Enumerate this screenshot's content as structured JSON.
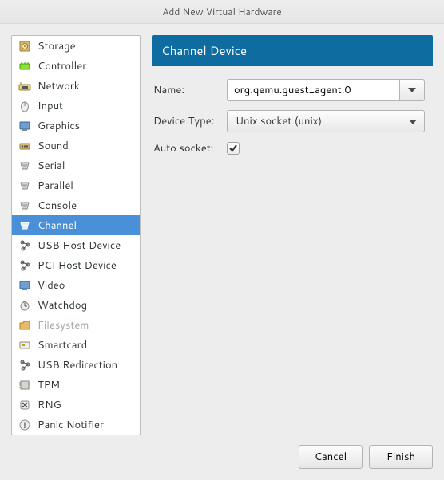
{
  "window": {
    "title": "Add New Virtual Hardware"
  },
  "sidebar": {
    "items": [
      {
        "label": "Storage",
        "icon": "storage",
        "selected": false,
        "disabled": false
      },
      {
        "label": "Controller",
        "icon": "controller",
        "selected": false,
        "disabled": false
      },
      {
        "label": "Network",
        "icon": "network",
        "selected": false,
        "disabled": false
      },
      {
        "label": "Input",
        "icon": "input",
        "selected": false,
        "disabled": false
      },
      {
        "label": "Graphics",
        "icon": "graphics",
        "selected": false,
        "disabled": false
      },
      {
        "label": "Sound",
        "icon": "sound",
        "selected": false,
        "disabled": false
      },
      {
        "label": "Serial",
        "icon": "serial",
        "selected": false,
        "disabled": false
      },
      {
        "label": "Parallel",
        "icon": "parallel",
        "selected": false,
        "disabled": false
      },
      {
        "label": "Console",
        "icon": "console",
        "selected": false,
        "disabled": false
      },
      {
        "label": "Channel",
        "icon": "channel",
        "selected": true,
        "disabled": false
      },
      {
        "label": "USB Host Device",
        "icon": "usb",
        "selected": false,
        "disabled": false
      },
      {
        "label": "PCI Host Device",
        "icon": "pci",
        "selected": false,
        "disabled": false
      },
      {
        "label": "Video",
        "icon": "video",
        "selected": false,
        "disabled": false
      },
      {
        "label": "Watchdog",
        "icon": "watchdog",
        "selected": false,
        "disabled": false
      },
      {
        "label": "Filesystem",
        "icon": "filesystem",
        "selected": false,
        "disabled": true
      },
      {
        "label": "Smartcard",
        "icon": "smartcard",
        "selected": false,
        "disabled": false
      },
      {
        "label": "USB Redirection",
        "icon": "usbredir",
        "selected": false,
        "disabled": false
      },
      {
        "label": "TPM",
        "icon": "tpm",
        "selected": false,
        "disabled": false
      },
      {
        "label": "RNG",
        "icon": "rng",
        "selected": false,
        "disabled": false
      },
      {
        "label": "Panic Notifier",
        "icon": "panic",
        "selected": false,
        "disabled": false
      }
    ]
  },
  "panel": {
    "title": "Channel Device",
    "name_label": "Name:",
    "name_value": "org.qemu.guest_agent.0",
    "device_type_label": "Device Type:",
    "device_type_value": "Unix socket (unix)",
    "auto_socket_label": "Auto socket:",
    "auto_socket_checked": true
  },
  "footer": {
    "cancel": "Cancel",
    "finish": "Finish"
  }
}
